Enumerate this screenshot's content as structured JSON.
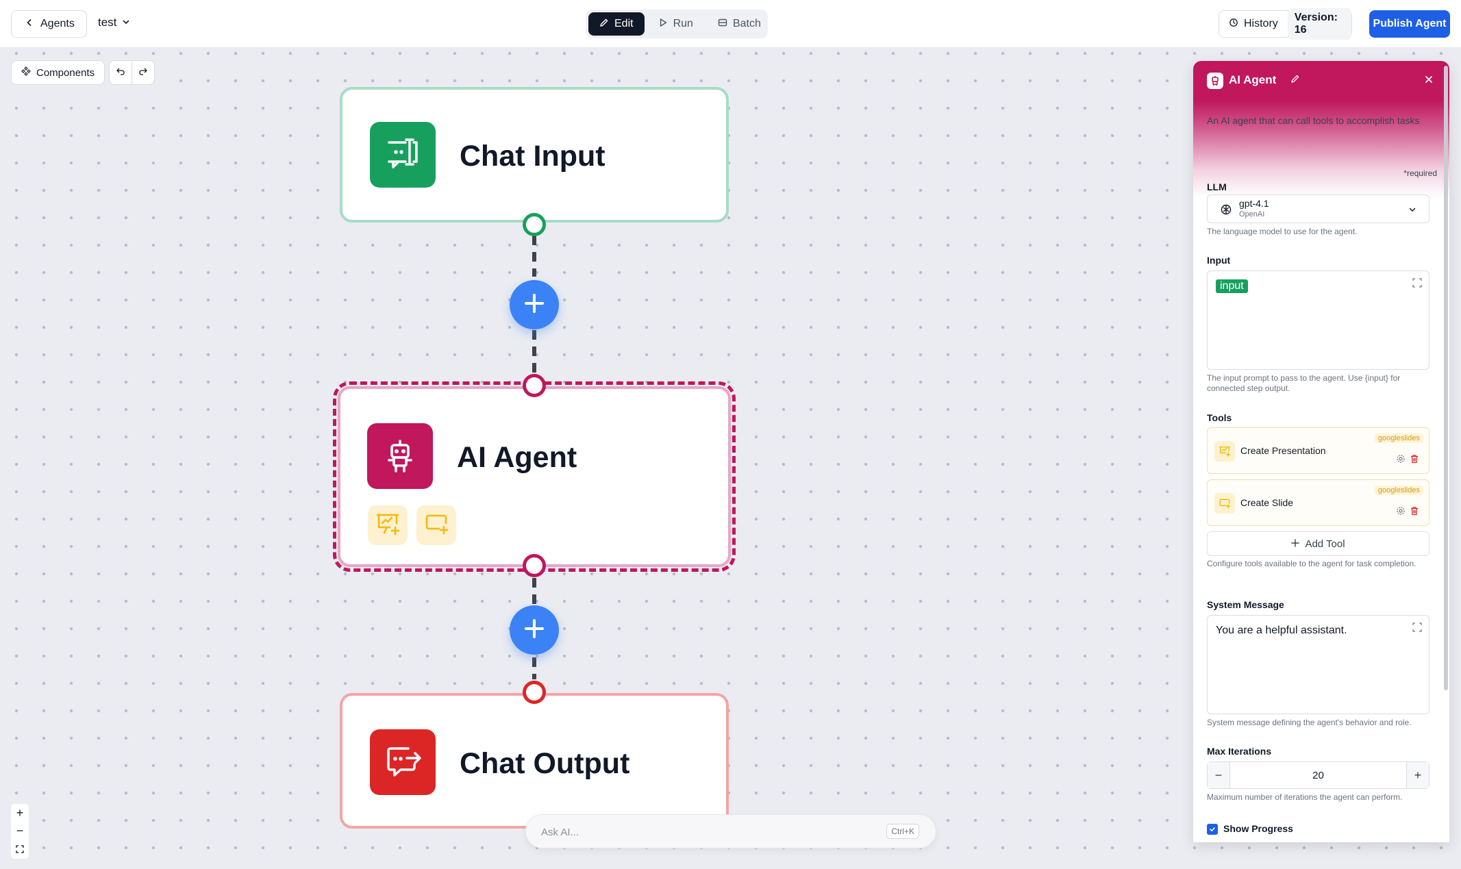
{
  "topbar": {
    "back_label": "Agents",
    "project_name": "test",
    "modes": [
      "Edit",
      "Run",
      "Batch"
    ],
    "history_label": "History",
    "version_label": "Version: 16",
    "publish_label": "Publish Agent"
  },
  "toolbar": {
    "components_label": "Components"
  },
  "nodes": {
    "chat_input": "Chat Input",
    "ai_agent": "AI Agent",
    "chat_output": "Chat Output"
  },
  "ask_ai": {
    "placeholder": "Ask AI...",
    "shortcut": "Ctrl+K"
  },
  "panel": {
    "title": "AI Agent",
    "description": "An AI agent that can call tools to accomplish tasks",
    "required_note": "*required",
    "llm": {
      "label": "LLM",
      "model": "gpt-4.1",
      "provider": "OpenAI",
      "help": "The language model to use for the agent."
    },
    "input": {
      "label": "Input",
      "chip": "input",
      "help": "The input prompt to pass to the agent. Use {input} for connected step output."
    },
    "tools": {
      "label": "Tools",
      "items": [
        {
          "name": "Create Presentation",
          "badge": "googleslides"
        },
        {
          "name": "Create Slide",
          "badge": "googleslides"
        }
      ],
      "add_label": "Add Tool",
      "help": "Configure tools available to the agent for task completion."
    },
    "system_message": {
      "label": "System Message",
      "value": "You are a helpful assistant.",
      "help": "System message defining the agent's behavior and role."
    },
    "max_iterations": {
      "label": "Max Iterations",
      "value": "20",
      "help": "Maximum number of iterations the agent can perform."
    },
    "show_progress": {
      "label": "Show Progress",
      "checked": true
    }
  },
  "colors": {
    "accent": "#c0175d",
    "primary": "#1d5fe6",
    "input_node": "#17a05d",
    "output_node": "#dc2626",
    "add_button": "#3b82f6",
    "tool_icon": "#f5b90b"
  }
}
